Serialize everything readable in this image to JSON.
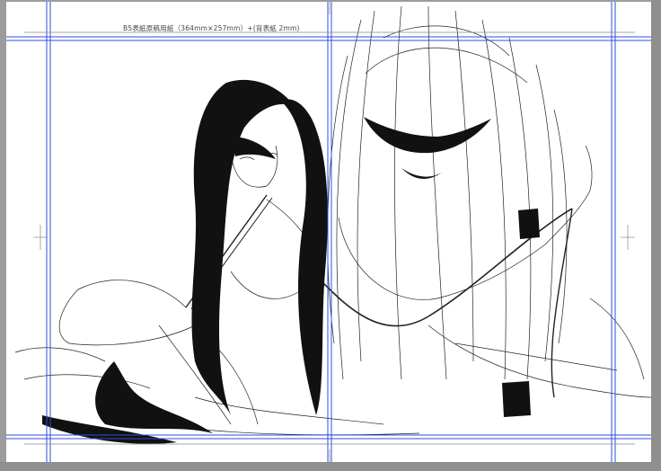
{
  "document": {
    "title": "B5表紙原稿用紙（364mm×257mm）+(背表紙 2mm)"
  },
  "colors": {
    "guide": "#2f4fd9",
    "pasteboard": "#9c9c9c",
    "paper": "#ffffff",
    "ink": "#111111"
  },
  "icons": {
    "artwork": "lineart-illustration"
  }
}
